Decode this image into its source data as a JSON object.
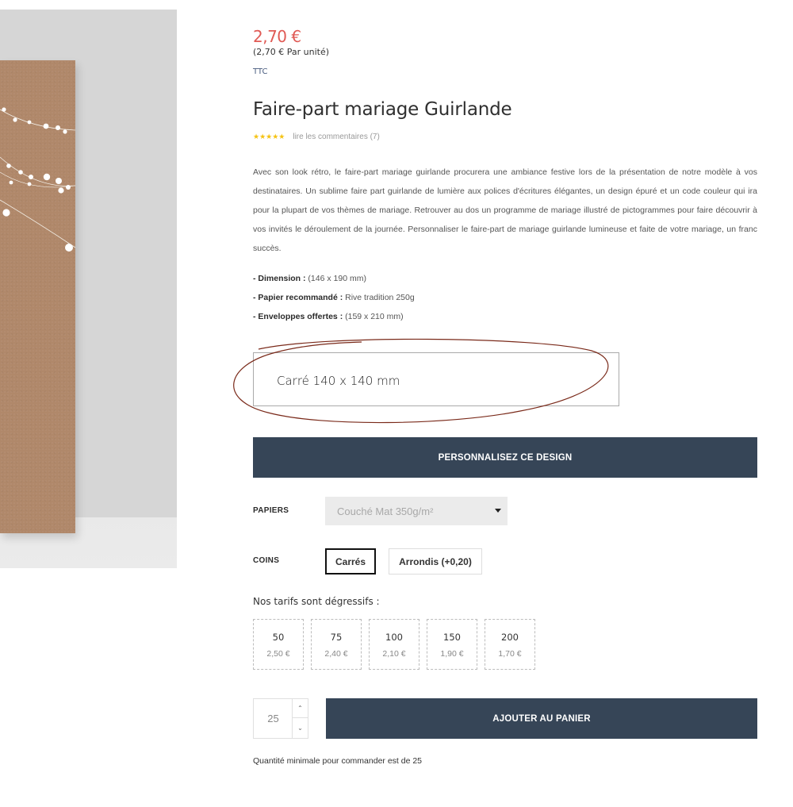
{
  "product": {
    "price": "2,70 €",
    "unit_price": "(2,70 € Par unité)",
    "tax_label": "TTC",
    "title": "Faire-part mariage Guirlande",
    "stars": "★★★★★",
    "reviews_link": "lire les commentaires (7)",
    "description": "Avec son look rétro, le faire-part mariage guirlande procurera une ambiance festive lors de la présentation de notre modèle à vos destinataires. Un sublime faire part guirlande de lumière aux polices d'écritures élégantes, un design épuré et un code couleur qui ira pour la plupart de vos thèmes de mariage. Retrouver au dos un programme de mariage illustré de pictogrammes pour faire découvrir à vos invités le déroulement de la journée. Personnaliser le faire-part de mariage guirlande lumineuse et faite de votre mariage, un franc succès.",
    "specs": [
      {
        "label": "- Dimension :",
        "value": " (146 x 190 mm)"
      },
      {
        "label": "- Papier recommandé :",
        "value": " Rive tradition 250g"
      },
      {
        "label": "- Enveloppes offertes :",
        "value": " (159 x 210 mm)"
      }
    ]
  },
  "format": {
    "label": "Carré 140 x 140 mm"
  },
  "personalize_button": "PERSONNALISEZ CE DESIGN",
  "papers": {
    "label": "PAPIERS",
    "selected": "Couché Mat 350g/m²"
  },
  "corners": {
    "label": "COINS",
    "options": [
      "Carrés",
      "Arrondis (+0,20)"
    ],
    "selected": "Carrés"
  },
  "tiers": {
    "title": "Nos tarifs sont dégressifs :",
    "items": [
      {
        "qty": "50",
        "price": "2,50 €"
      },
      {
        "qty": "75",
        "price": "2,40 €"
      },
      {
        "qty": "100",
        "price": "2,10 €"
      },
      {
        "qty": "150",
        "price": "1,90 €"
      },
      {
        "qty": "200",
        "price": "1,70 €"
      }
    ]
  },
  "quantity": {
    "value": "25",
    "up_icon": "chevron-up-icon",
    "down_icon": "chevron-down-icon"
  },
  "add_to_cart": "AJOUTER AU PANIER",
  "min_note": "Quantité minimale pour commander est de 25",
  "colors": {
    "price": "#e05a55",
    "button": "#364557",
    "stars": "#f5c313",
    "annotation": "#7a2a1a",
    "kraft": "#b0886a"
  }
}
